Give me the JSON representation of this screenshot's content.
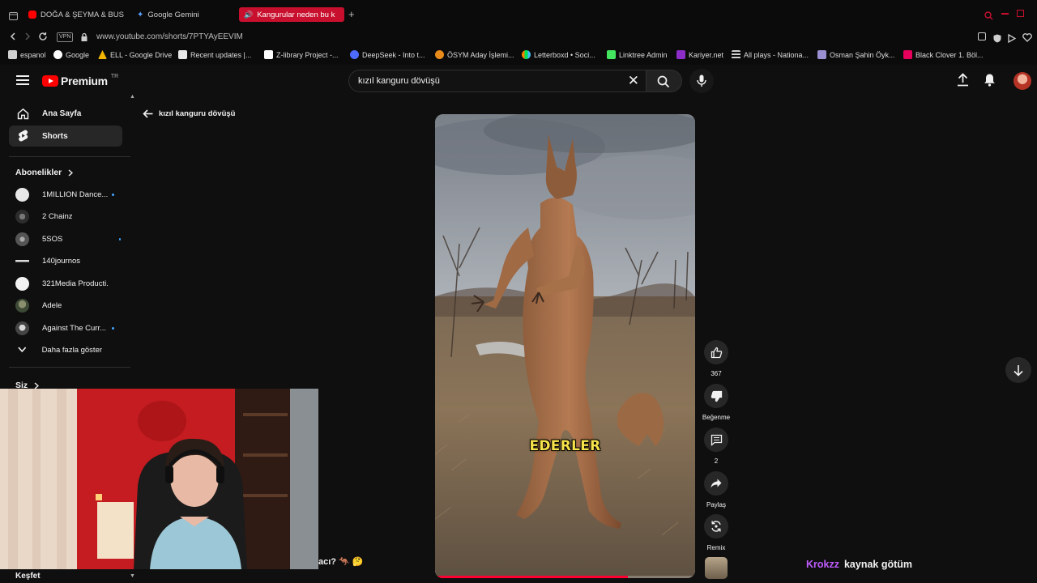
{
  "browser": {
    "tabs": [
      {
        "label": "DOĞA & ŞEYMA & BUSE &",
        "icon": "youtube-icon",
        "active": false
      },
      {
        "label": "Google Gemini",
        "icon": "gemini-icon",
        "active": false
      },
      {
        "label": "Kangurular neden bu k",
        "icon": "speaker-icon",
        "active": true
      }
    ],
    "new_tab": "+",
    "vpn_label": "VPN",
    "url": "www.youtube.com/shorts/7PTYAyEEVIM",
    "bookmarks": [
      {
        "label": "espanol",
        "icon": "folder-icon",
        "color": "#cfcfcf"
      },
      {
        "label": "Google",
        "icon": "google-icon",
        "color": "#ffffff"
      },
      {
        "label": "ELL - Google Drive",
        "icon": "drive-icon",
        "color": "#f5b400"
      },
      {
        "label": "Recent updates |...",
        "icon": "doc-icon",
        "color": "#e8e8e8"
      },
      {
        "label": "Z-library Project -...",
        "icon": "zlibrary-icon",
        "color": "#ffffff"
      },
      {
        "label": "DeepSeek - Into t...",
        "icon": "deepseek-icon",
        "color": "#4d6bfe"
      },
      {
        "label": "ÖSYM Aday İşlemi...",
        "icon": "osym-icon",
        "color": "#e88b1a"
      },
      {
        "label": "Letterboxd • Soci...",
        "icon": "letterboxd-icon",
        "color": "#40bcf4"
      },
      {
        "label": "Linktree Admin",
        "icon": "linktree-icon",
        "color": "#43e55e"
      },
      {
        "label": "Kariyer.net",
        "icon": "kariyer-icon",
        "color": "#8c2dc8"
      },
      {
        "label": "All plays - Nationa...",
        "icon": "list-icon",
        "color": "#cfcfcf"
      },
      {
        "label": "Osman Şahin Öyk...",
        "icon": "book-icon",
        "color": "#9a8fd0"
      },
      {
        "label": "Black Clover 1. Böl...",
        "icon": "anime-icon",
        "color": "#e6005c"
      }
    ]
  },
  "youtube": {
    "logo_text": "Premium",
    "logo_region": "TR",
    "search_query": "kızıl kanguru dövüşü",
    "sidebar": {
      "main": [
        {
          "label": "Ana Sayfa",
          "icon": "home-icon",
          "selected": false
        },
        {
          "label": "Shorts",
          "icon": "shorts-icon",
          "selected": true
        }
      ],
      "subscriptions_header": "Abonelikler",
      "subscriptions": [
        {
          "name": "1MILLION Dance...",
          "new": true,
          "color": "#e8e8e8"
        },
        {
          "name": "2 Chainz",
          "new": false,
          "color": "#3a3a3a"
        },
        {
          "name": "5SOS",
          "new": true,
          "color": "#6d6d6d"
        },
        {
          "name": "140journos",
          "new": false,
          "color": "#111111"
        },
        {
          "name": "321Media Producti...",
          "new": false,
          "color": "#f2f2f2"
        },
        {
          "name": "Adele",
          "new": false,
          "color": "#4a5a3e"
        },
        {
          "name": "Against The Curr...",
          "new": true,
          "color": "#9a9a9a"
        }
      ],
      "show_more": "Daha fazla göster",
      "you_header": "Siz",
      "explore_header": "Keşfet"
    },
    "back_label": "kızıl kanguru dövüşü",
    "short": {
      "caption": "EDERLER",
      "progress": 0.74
    },
    "actions": {
      "like_count": "367",
      "dislike_label": "Beğenme",
      "comment_count": "2",
      "share_label": "Paylaş",
      "remix_label": "Remix"
    },
    "partial_text": "acı? 🦘 🤔"
  },
  "stream": {
    "chat_user": "Krokzz",
    "chat_message": "kaynak götüm"
  },
  "colors": {
    "accent": "#ff0000",
    "active_tab": "#c8102e",
    "caption": "#f6e24a",
    "progress": "#ff0033"
  }
}
